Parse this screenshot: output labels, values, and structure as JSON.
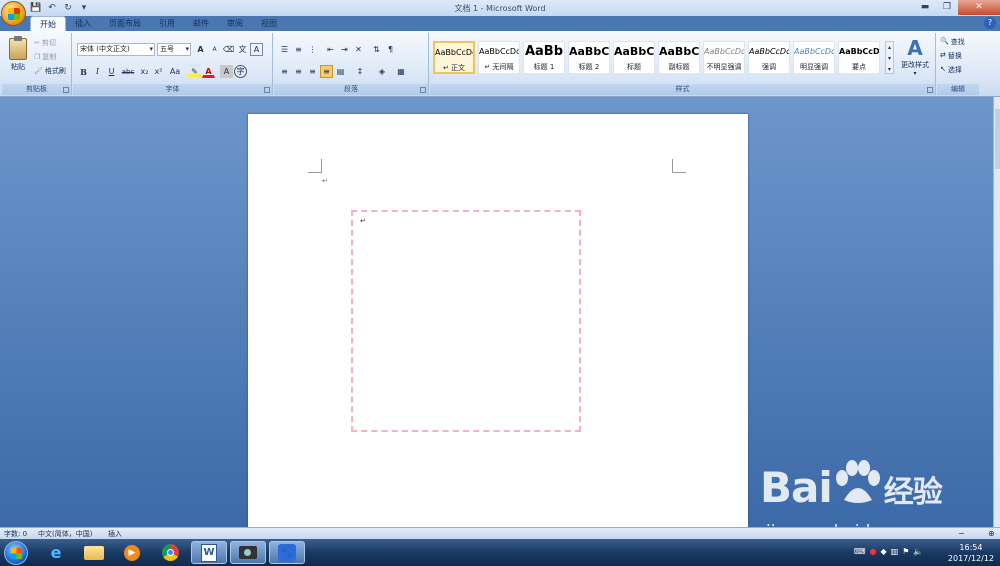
{
  "window": {
    "title": "文档 1 - Microsoft Word",
    "controls": {
      "minimize": "▬",
      "restore": "❐",
      "close": "✕"
    }
  },
  "quick_access": {
    "save": "💾",
    "undo": "↶",
    "redo": "↻",
    "customize": "▾"
  },
  "tabs": [
    {
      "label": "开始",
      "active": true
    },
    {
      "label": "插入"
    },
    {
      "label": "页面布局"
    },
    {
      "label": "引用"
    },
    {
      "label": "邮件"
    },
    {
      "label": "审阅"
    },
    {
      "label": "视图"
    }
  ],
  "ribbon": {
    "clipboard": {
      "label": "剪贴板",
      "paste": "粘贴",
      "cut": "剪切",
      "copy": "复制",
      "format_painter": "格式刷"
    },
    "font": {
      "label": "字体",
      "font_name": "宋体 (中文正文)",
      "font_size": "五号",
      "bold": "B",
      "italic": "I",
      "underline": "U",
      "strikethrough": "abc",
      "subscript": "x₂",
      "superscript": "x²",
      "change_case": "Aa",
      "grow": "A",
      "shrink": "A",
      "font_color": "A",
      "phonetic": "ruby",
      "char_border": "A",
      "encircle": "字"
    },
    "paragraph": {
      "label": "段落"
    },
    "styles": {
      "label": "样式",
      "items": [
        {
          "preview": "AaBbCcDd",
          "name": "↵ 正文",
          "selected": true
        },
        {
          "preview": "AaBbCcDd",
          "name": "↵ 无间隔"
        },
        {
          "preview": "AaBb",
          "name": "标题 1"
        },
        {
          "preview": "AaBbC",
          "name": "标题 2"
        },
        {
          "preview": "AaBbC",
          "name": "标题"
        },
        {
          "preview": "AaBbC",
          "name": "副标题"
        },
        {
          "preview": "AaBbCcDd",
          "name": "不明显强调"
        },
        {
          "preview": "AaBbCcDd",
          "name": "强调"
        },
        {
          "preview": "AaBbCcDd",
          "name": "明显强调"
        },
        {
          "preview": "AaBbCcDd",
          "name": "要点"
        }
      ],
      "change_styles": "更改样式"
    },
    "editing": {
      "label": "编辑",
      "find": "查找",
      "replace": "替换",
      "select": "选择"
    }
  },
  "document": {
    "paragraph_mark": "↵",
    "textbox_paragraph_mark": "↵"
  },
  "statusbar": {
    "word_count": "字数: 0",
    "language": "中文(简体，中国)",
    "mode": "插入"
  },
  "watermark": {
    "logo": "Bai",
    "logo_suffix": "经验",
    "url": "jingyan.baidu.com"
  },
  "taskbar": {
    "time": "16:54",
    "date": "2017/12/12"
  },
  "colors": {
    "ribbon_top": "#f6f9fd",
    "doc_bg": "#4a77b2",
    "textbox_border": "#f2b3bd",
    "taskbar": "#1b3a63"
  }
}
